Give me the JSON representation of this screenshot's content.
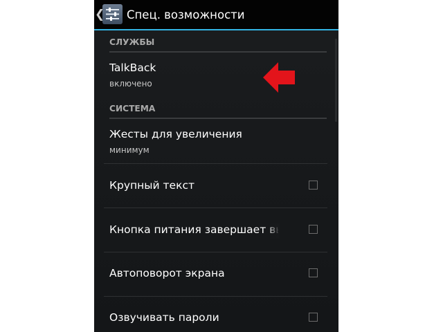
{
  "header": {
    "title": "Спец. возможности",
    "back_icon": "chevron-left-icon",
    "app_icon": "accessibility-settings-icon",
    "accent_color": "#33b5e5"
  },
  "sections": [
    {
      "header": "СЛУЖБЫ",
      "items": [
        {
          "title": "TalkBack",
          "summary": "включено"
        }
      ]
    },
    {
      "header": "СИСТЕМА",
      "items": [
        {
          "title": "Жесты для увеличения",
          "summary": "минимум"
        },
        {
          "title": "Крупный текст",
          "checked": false
        },
        {
          "title": "Кнопка питания завершает вызов",
          "checked": false
        },
        {
          "title": "Автоповорот экрана",
          "checked": false
        },
        {
          "title": "Озвучивать пароли",
          "checked": false
        }
      ]
    }
  ],
  "annotation": {
    "icon": "red-arrow-left-icon",
    "color": "#e3141b"
  }
}
